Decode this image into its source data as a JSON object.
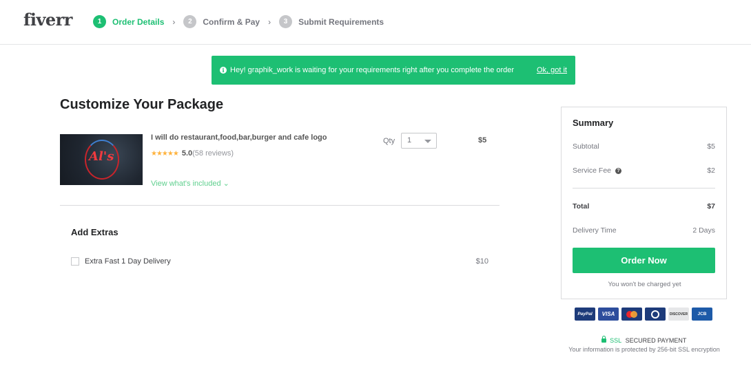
{
  "header": {
    "logo": "fiverr",
    "steps": [
      {
        "num": "1",
        "label": "Order Details",
        "active": true
      },
      {
        "num": "2",
        "label": "Confirm & Pay",
        "active": false
      },
      {
        "num": "3",
        "label": "Submit Requirements",
        "active": false
      }
    ],
    "separator": "›"
  },
  "banner": {
    "icon": "info-icon",
    "info_glyph": "i",
    "message": "Hey! graphik_work is waiting for your requirements right after you complete the order",
    "dismiss_label": "Ok, got it"
  },
  "package": {
    "title": "Customize Your Package",
    "image_text": "Al's",
    "gig_title": "I will do restaurant,food,bar,burger and cafe logo",
    "stars": "★★★★★",
    "rating": "5.0",
    "reviews": "(58 reviews)",
    "view_included": "View what's included ⌄",
    "qty_label": "Qty",
    "qty_value": "1",
    "price": "$5"
  },
  "extras": {
    "title": "Add Extras",
    "items": [
      {
        "label": "Extra Fast 1 Day Delivery",
        "price": "$10",
        "checked": false
      }
    ]
  },
  "summary": {
    "title": "Summary",
    "subtotal_label": "Subtotal",
    "subtotal_value": "$5",
    "service_fee_label": "Service Fee",
    "service_fee_help": "?",
    "service_fee_value": "$2",
    "total_label": "Total",
    "total_value": "$7",
    "delivery_label": "Delivery Time",
    "delivery_value": "2 Days",
    "order_button": "Order Now",
    "charged_note": "You won't be charged yet"
  },
  "payment_cards": [
    {
      "name": "PayPal",
      "label": "PayPal"
    },
    {
      "name": "Visa",
      "label": "VISA"
    },
    {
      "name": "Mastercard",
      "label": ""
    },
    {
      "name": "Diners Club",
      "label": ""
    },
    {
      "name": "Discover",
      "label": "DISCOVER"
    },
    {
      "name": "JCB",
      "label": "JCB"
    }
  ],
  "security": {
    "ssl": "SSL",
    "secured": "SECURED PAYMENT",
    "note": "Your information is protected by 256-bit SSL encryption"
  },
  "colors": {
    "brand_green": "#1dbf73",
    "text_dark": "#222325",
    "star": "#ffb33e"
  }
}
